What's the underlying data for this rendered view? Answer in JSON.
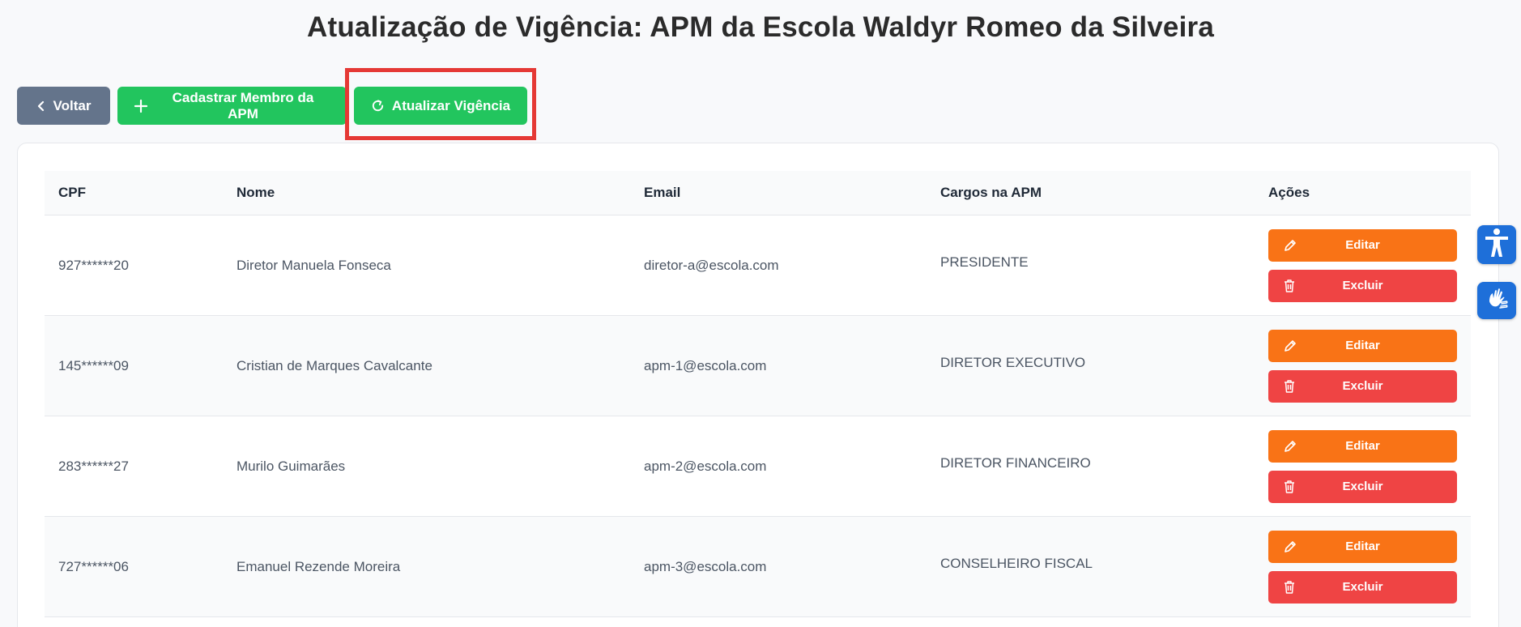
{
  "page": {
    "title": "Atualização de Vigência: APM da Escola Waldyr Romeo da Silveira"
  },
  "toolbar": {
    "back_label": "Voltar",
    "back_icon": "chevron-left-icon",
    "add_member_label": "Cadastrar Membro da APM",
    "add_member_icon": "plus-icon",
    "update_label": "Atualizar Vigência",
    "update_icon": "refresh-icon"
  },
  "table": {
    "columns": [
      "CPF",
      "Nome",
      "Email",
      "Cargos na APM",
      "Ações"
    ],
    "rows": [
      {
        "cpf": "927******20",
        "nome": "Diretor Manuela Fonseca",
        "email": "diretor-a@escola.com",
        "cargo": "PRESIDENTE",
        "edit_label": "Editar",
        "delete_label": "Excluir"
      },
      {
        "cpf": "145******09",
        "nome": "Cristian de Marques Cavalcante",
        "email": "apm-1@escola.com",
        "cargo": "DIRETOR EXECUTIVO",
        "edit_label": "Editar",
        "delete_label": "Excluir"
      },
      {
        "cpf": "283******27",
        "nome": "Murilo Guimarães",
        "email": "apm-2@escola.com",
        "cargo": "DIRETOR FINANCEIRO",
        "edit_label": "Editar",
        "delete_label": "Excluir"
      },
      {
        "cpf": "727******06",
        "nome": "Emanuel Rezende Moreira",
        "email": "apm-3@escola.com",
        "cargo": "CONSELHEIRO FISCAL",
        "edit_label": "Editar",
        "delete_label": "Excluir"
      }
    ]
  },
  "colors": {
    "back_button": "#64748b",
    "green_button": "#22c55e",
    "edit_button": "#f97316",
    "delete_button": "#ef4444",
    "highlight": "#e53935",
    "widget": "#1e6fd9"
  },
  "widgets": {
    "accessibility_icon": "accessibility-icon",
    "sign_language_icon": "sign-language-icon"
  }
}
